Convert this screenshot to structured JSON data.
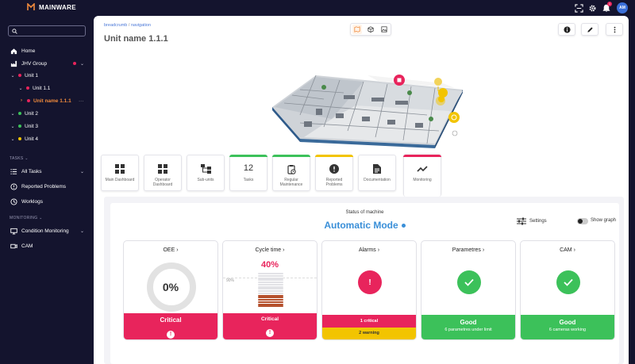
{
  "app": {
    "brand": "MAINWARE",
    "avatar_initials": "AM",
    "notification_count": "1"
  },
  "sidebar": {
    "search_placeholder": "",
    "home": "Home",
    "tree": [
      {
        "label": "JHV Group",
        "color": "#e8245c"
      },
      {
        "label": "Unit 1",
        "color": "#e8245c"
      },
      {
        "label": "Unit 1.1",
        "color": "#e8245c"
      },
      {
        "label": "Unit name 1.1.1",
        "color": "#e8245c"
      },
      {
        "label": "Unit 2",
        "color": "#3cc15a"
      },
      {
        "label": "Unit 3",
        "color": "#3cc15a"
      },
      {
        "label": "Unit 4",
        "color": "#f2c400"
      }
    ],
    "tasks_header": "TASKS",
    "all_tasks": "All Tasks",
    "reported_problems": "Reported Problems",
    "worklogs": "Worklogs",
    "monitoring_header": "MONITORING",
    "condition_monitoring": "Condition Monitoring",
    "cam": "CAM"
  },
  "header": {
    "breadcrumb_a": "breadcrumb",
    "breadcrumb_sep": "/",
    "breadcrumb_b": "navigation",
    "title": "Unit name 1.1.1"
  },
  "tiles": [
    {
      "label": "Main Dashboard",
      "icon": "grid-icon"
    },
    {
      "label": "Operator Dashboard",
      "icon": "grid-icon"
    },
    {
      "label": "Sub-units",
      "icon": "hierarchy-icon"
    },
    {
      "label": "Tasks",
      "number": "12",
      "bar": "#3cc15a"
    },
    {
      "label": "Regular Maintenance",
      "icon": "clipboard-clock-icon",
      "bar": "#3cc15a"
    },
    {
      "label": "Reported Problems",
      "icon": "alert-icon",
      "bar": "#f2c400"
    },
    {
      "label": "Documentation",
      "icon": "document-icon"
    },
    {
      "label": "Monitoring",
      "icon": "trend-icon",
      "bar": "#e8245c"
    }
  ],
  "panel": {
    "status_label": "Status of machine",
    "status_mode": "Automatic Mode",
    "settings_label": "Settings",
    "show_graph_label": "Show graph"
  },
  "cards": {
    "oee": {
      "title": "OEE",
      "value": "0%",
      "footer": "Critical",
      "color": "#e8245c"
    },
    "cycle": {
      "title": "Cycle time",
      "value": "40%",
      "marker": "90%",
      "footer": "Critical",
      "color": "#e8245c",
      "level": 0.4
    },
    "alarms": {
      "title": "Alarms",
      "footer_a": "1 critical",
      "footer_b": "2 warning",
      "color_a": "#e8245c",
      "color_b": "#f2c400"
    },
    "params": {
      "title": "Parametres",
      "footer": "Good",
      "sub": "6 parametres under limit",
      "color": "#3cc15a"
    },
    "cam": {
      "title": "CAM",
      "footer": "Good",
      "sub": "6 cameras working",
      "color": "#3cc15a"
    }
  }
}
